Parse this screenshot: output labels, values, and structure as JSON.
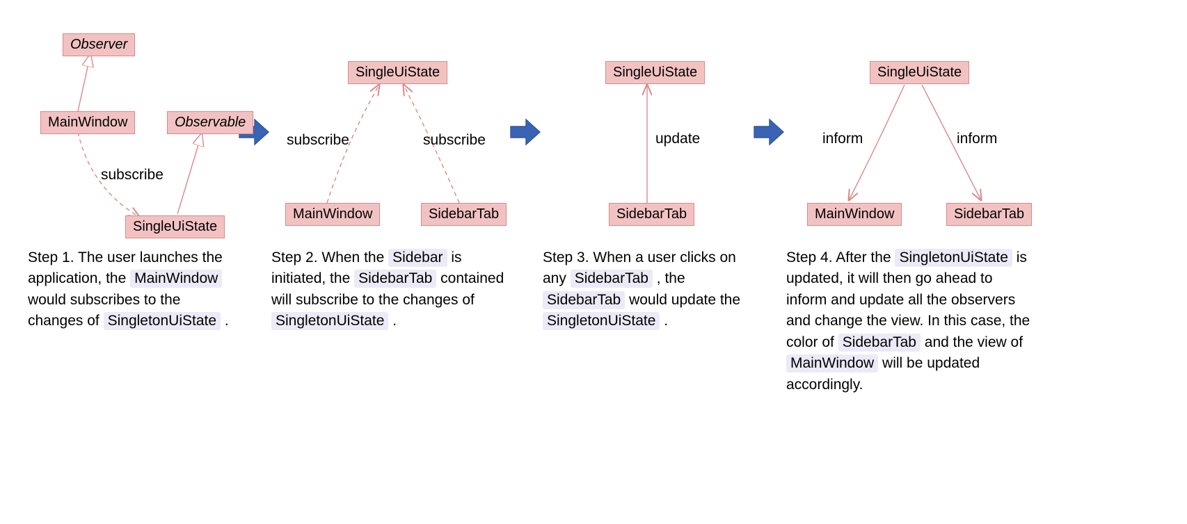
{
  "nodes": {
    "observer": "Observer",
    "observable": "Observable",
    "mainwindow": "MainWindow",
    "sidebartab": "SidebarTab",
    "singleuistate": "SingleUiState"
  },
  "edge_labels": {
    "subscribe": "subscribe",
    "update": "update",
    "inform": "inform"
  },
  "captions": {
    "step1": {
      "prefix": "Step 1. The user launches the application, the ",
      "c1": "MainWindow",
      "mid1": " would subscribes to the changes of ",
      "c2": "SingletonUiState",
      "suffix": " ."
    },
    "step2": {
      "prefix": "Step 2. When the ",
      "c1": "Sidebar",
      "mid1": " is initiated, the ",
      "c2": "SidebarTab",
      "mid2": " contained will subscribe to the changes of ",
      "c3": "SingletonUiState",
      "suffix": " ."
    },
    "step3": {
      "prefix": "Step 3. When a user clicks on any ",
      "c1": "SidebarTab",
      "mid1": " , the ",
      "c2": "SidebarTab",
      "mid2": " would update the ",
      "c3": "SingletonUiState",
      "suffix": " ."
    },
    "step4": {
      "prefix": "Step 4. After the ",
      "c1": "SingletonUiState",
      "mid1": " is updated, it will then go ahead to inform and update all the observers and change the view. In this case, the color of ",
      "c2": "SidebarTab",
      "mid2": " and the view of ",
      "c3": "MainWindow",
      "suffix": " will be updated accordingly."
    }
  },
  "colors": {
    "node_fill": "#f2c2c2",
    "node_border": "#d98888",
    "arrow_fill": "#3a63b5",
    "arrow_border": "#2f569c",
    "edge": "#d98888",
    "code_bg": "#eceaf6"
  }
}
